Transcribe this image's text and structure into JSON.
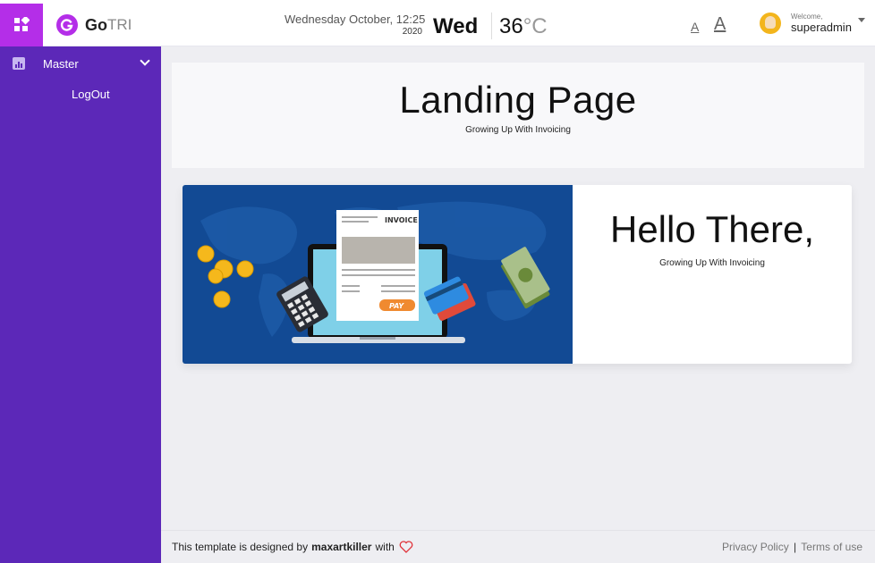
{
  "app": {
    "brand_name": "Go",
    "brand_suffix": "TRI"
  },
  "header": {
    "date_text": "Wednesday October, 12:25",
    "year": "2020",
    "day": "Wed",
    "temperature": "36",
    "temperature_unit": "°C",
    "font_small": "A",
    "font_large": "A",
    "welcome": "Welcome,",
    "username": "superadmin"
  },
  "sidebar": {
    "items": [
      {
        "label": "Master",
        "icon": "chart-icon"
      }
    ],
    "logout_label": "LogOut"
  },
  "main": {
    "hero_title": "Landing Page",
    "hero_subtitle": "Growing Up With Invoicing",
    "card_title": "Hello There,",
    "card_subtitle": "Growing Up With Invoicing",
    "illustration": {
      "invoice_label": "INVOICE",
      "pay_label": "PAY"
    }
  },
  "footer": {
    "left_prefix": "This template is designed by",
    "author": "maxartkiller",
    "left_suffix": "with",
    "privacy": "Privacy Policy",
    "separator": "|",
    "terms": "Terms of use"
  },
  "colors": {
    "accent": "#b42ee8",
    "sidebar": "#5c28b8",
    "banner": "#124a94",
    "heart": "#e0333a"
  }
}
